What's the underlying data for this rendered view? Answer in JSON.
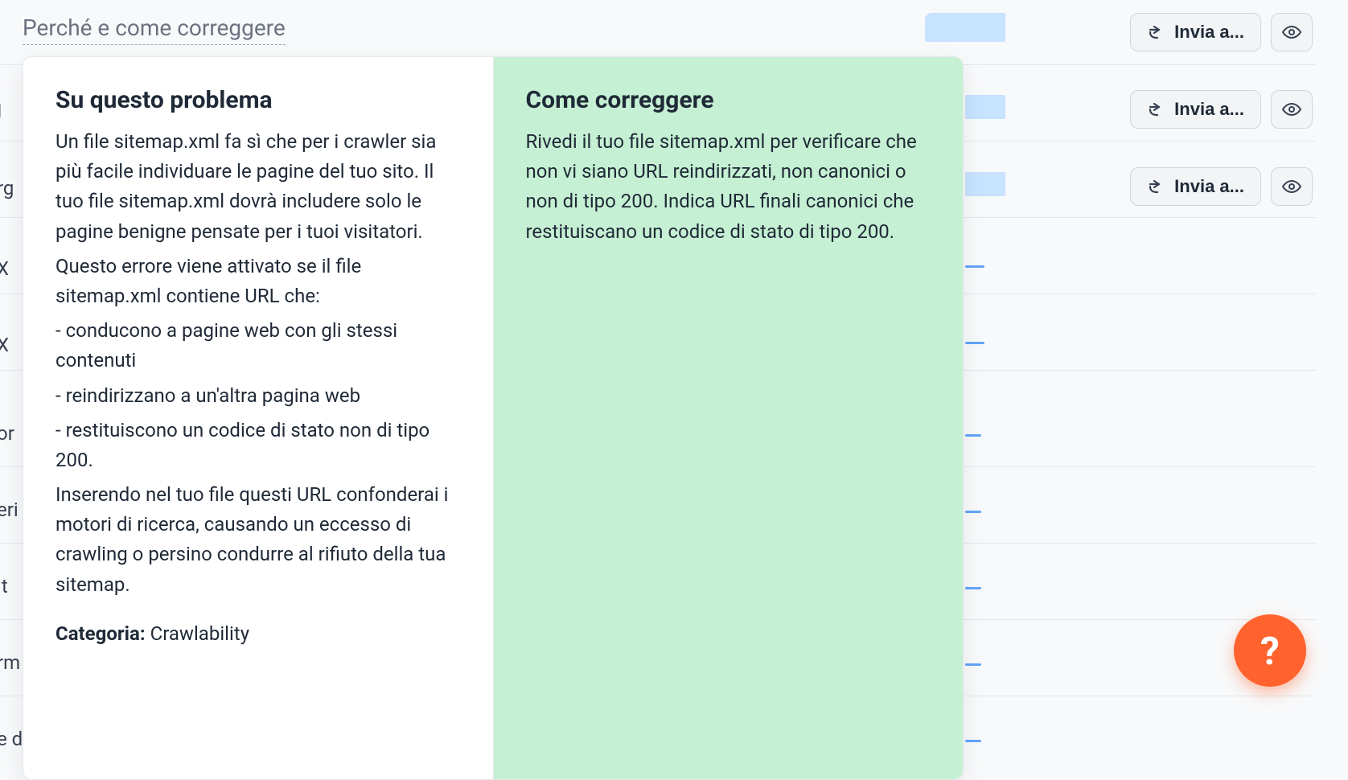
{
  "top_link": "Perché e come correggere",
  "popover": {
    "about_heading": "Su questo problema",
    "about_p1": "Un file sitemap.xml fa sì che per i crawler sia più facile individuare le pagine del tuo sito. Il tuo file sitemap.xml dovrà includere solo le pagine benigne pensate per i tuoi visitatori.",
    "about_p2": "Questo errore viene attivato se il file sitemap.xml contiene URL che:",
    "about_b1": "- conducono a pagine web con gli stessi contenuti",
    "about_b2": "- reindirizzano a un'altra pagina web",
    "about_b3": "- restituiscono un codice di stato non di tipo 200.",
    "about_p3": "Inserendo nel tuo file questi URL confonderai i motori di ricerca, causando un eccesso di crawling o persino condurre al rifiuto della tua sitemap.",
    "category_label": "Categoria:",
    "category_value": "Crawlability",
    "fix_heading": "Come correggere",
    "fix_p1": "Rivedi il tuo file sitemap.xml per verificare che non vi siano URL reindirizzati, non canonici o non di tipo 200. Indica URL finali canonici che restituiscano un codice di stato di tipo 200."
  },
  "actions": {
    "send_label": "Invia a..."
  },
  "help_label": "?",
  "side_fragments": [
    "I",
    "rg",
    "X",
    "X",
    "or",
    "eri",
    "lt",
    "rm",
    "e d"
  ]
}
